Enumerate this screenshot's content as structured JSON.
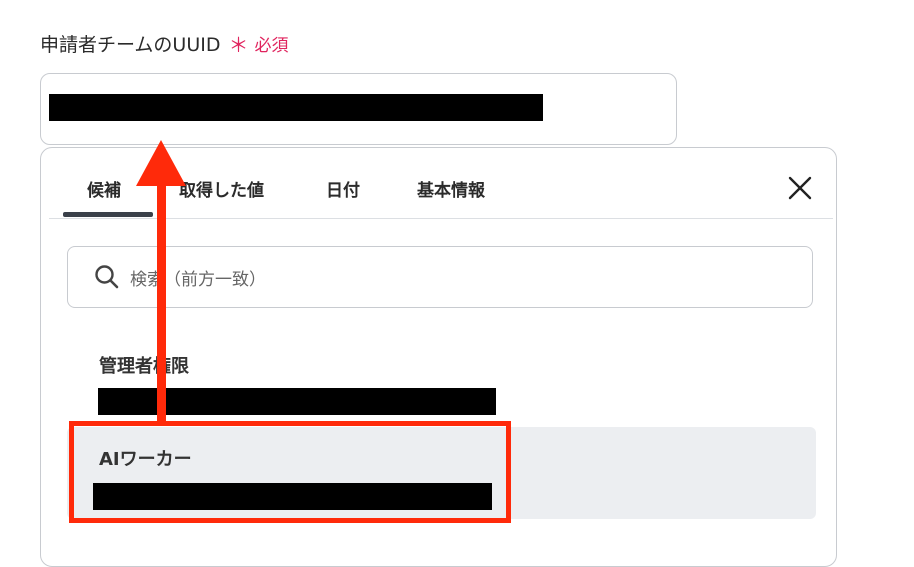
{
  "field": {
    "label": "申請者チームのUUID",
    "required_star": "＊",
    "required_text": "必須"
  },
  "tabs": [
    {
      "label": "候補",
      "active": true
    },
    {
      "label": "取得した値",
      "active": false
    },
    {
      "label": "日付",
      "active": false
    },
    {
      "label": "基本情報",
      "active": false
    }
  ],
  "search": {
    "placeholder": "検索（前方一致）",
    "icon": "search-icon"
  },
  "items": [
    {
      "title": "管理者権限"
    },
    {
      "title": "AIワーカー"
    }
  ],
  "colors": {
    "required": "#e0245e",
    "highlight": "#ff2a0a",
    "hover": "#eceef1"
  }
}
